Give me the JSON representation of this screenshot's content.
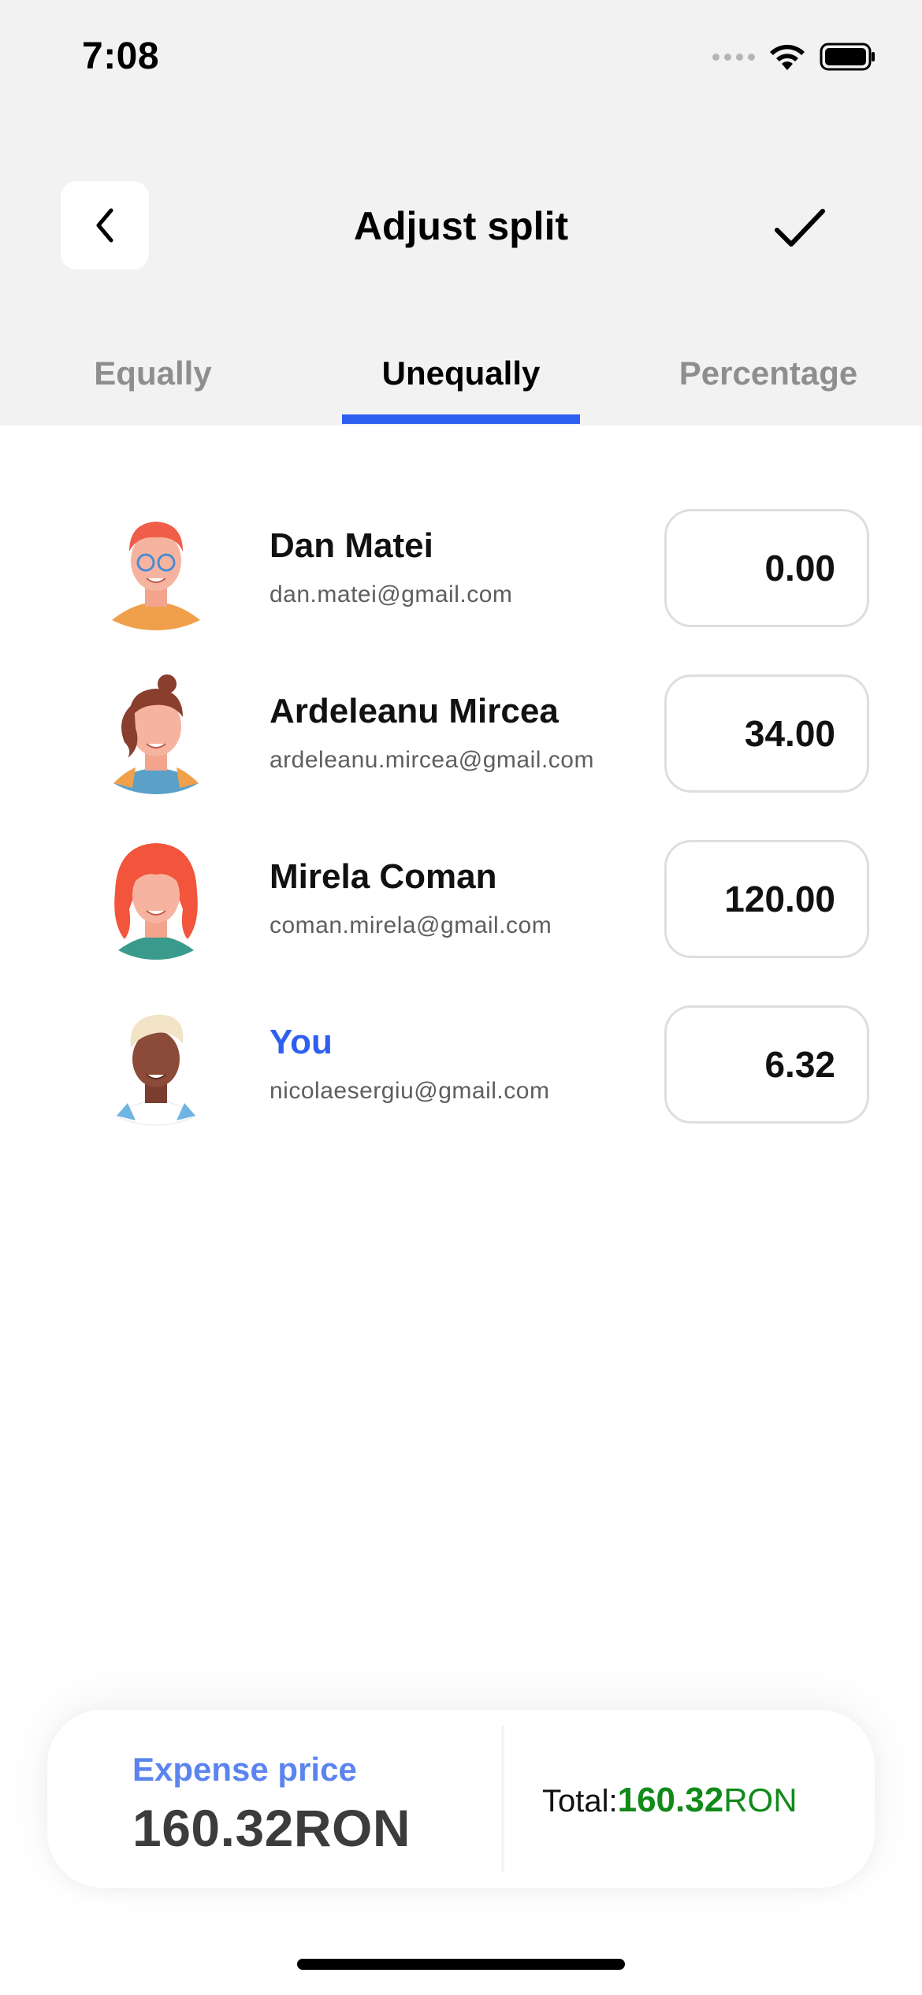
{
  "status_bar": {
    "time": "7:08"
  },
  "header": {
    "title": "Adjust split"
  },
  "tabs": [
    {
      "label": "Equally",
      "active": false
    },
    {
      "label": "Unequally",
      "active": true
    },
    {
      "label": "Percentage",
      "active": false
    }
  ],
  "participants": [
    {
      "name": "Dan Matei",
      "email": "dan.matei@gmail.com",
      "amount": "0.00",
      "avatar": "avatar-red-hair-glasses"
    },
    {
      "name": "Ardeleanu Mircea",
      "email": "ardeleanu.mircea@gmail.com",
      "amount": "34.00",
      "avatar": "avatar-brown-ponytail"
    },
    {
      "name": "Mirela Coman",
      "email": "coman.mirela@gmail.com",
      "amount": "120.00",
      "avatar": "avatar-red-long-hair"
    },
    {
      "name": "You",
      "email": "nicolaesergiu@gmail.com",
      "amount": "6.32",
      "avatar": "avatar-blond-dark-skin"
    }
  ],
  "summary": {
    "expense_label": "Expense price",
    "expense_value": "160.32RON",
    "total_label": "Total:",
    "total_amount": "160.32",
    "total_currency": "RON"
  },
  "colors": {
    "accent": "#2f5ff0",
    "expense_label": "#5b84ee",
    "total_green": "#118a1a",
    "header_bg": "#f2f2f2"
  }
}
